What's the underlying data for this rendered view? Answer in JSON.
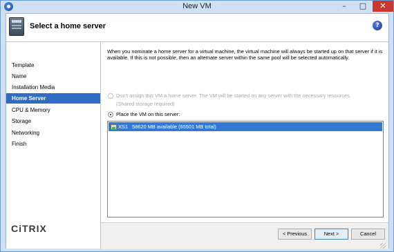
{
  "window": {
    "title": "New VM",
    "controls": {
      "minimize": "–",
      "maximize": "□",
      "close": "✕"
    }
  },
  "header": {
    "title": "Select a home server",
    "help": "?"
  },
  "sidebar": {
    "items": [
      {
        "label": "Template"
      },
      {
        "label": "Name"
      },
      {
        "label": "Installation Media"
      },
      {
        "label": "Home Server"
      },
      {
        "label": "CPU & Memory"
      },
      {
        "label": "Storage"
      },
      {
        "label": "Networking"
      },
      {
        "label": "Finish"
      }
    ],
    "active_index": 3,
    "logo": "CiTRIX"
  },
  "content": {
    "description": "When you nominate a home server for a virtual machine, the virtual machine will always be started up on that server if it is available. If this is not possible, then an alternate server within the same pool will be selected automatically.",
    "option_no_home": "Don't assign this VM a home server. The VM will be started on any server with the necessary resources.",
    "option_no_home_note": "(Shared storage required)",
    "option_place": "Place the VM on this server:",
    "servers": [
      {
        "name": "XS1",
        "memory": "58620 MB available (65501 MB total)"
      }
    ]
  },
  "footer": {
    "previous": "< Previous",
    "next": "Next >",
    "cancel": "Cancel"
  },
  "colors": {
    "selection": "#3378d3",
    "nav_active": "#2f6cc4",
    "close_button": "#c8382c"
  }
}
